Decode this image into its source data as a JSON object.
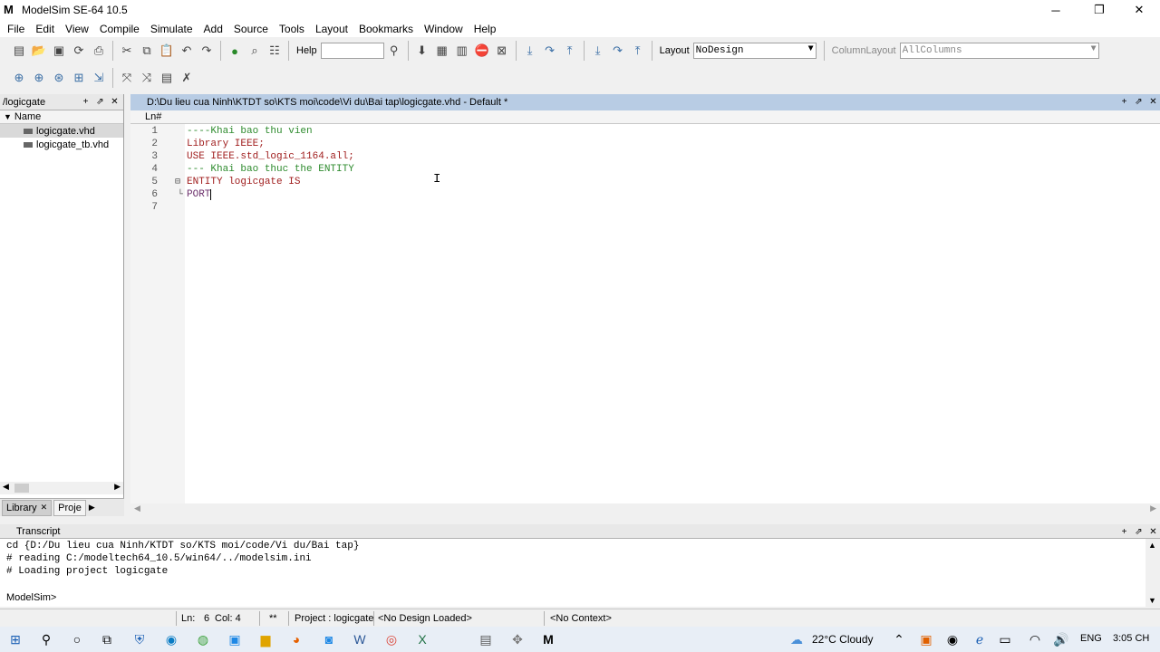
{
  "window": {
    "title": "ModelSim SE-64 10.5",
    "app_icon": "M",
    "minimize": "─",
    "restore": "❐",
    "close": "✕"
  },
  "menu": [
    "File",
    "Edit",
    "View",
    "Compile",
    "Simulate",
    "Add",
    "Source",
    "Tools",
    "Layout",
    "Bookmarks",
    "Window",
    "Help"
  ],
  "toolbar": {
    "help_label": "Help",
    "layout_label": "Layout",
    "layout_value": "NoDesign",
    "column_layout_label": "ColumnLayout",
    "column_layout_value": "AllColumns"
  },
  "left_panel": {
    "title": "/logicgate",
    "column_header": "Name",
    "files": [
      {
        "name": "logicgate.vhd",
        "selected": true
      },
      {
        "name": "logicgate_tb.vhd",
        "selected": false
      }
    ],
    "tabs": [
      "Library",
      "Proje"
    ]
  },
  "editor": {
    "path": "D:\\Du lieu cua Ninh\\KTDT so\\KTS moi\\code\\Vi du\\Bai tap\\logicgate.vhd - Default *",
    "ln_header": "Ln#",
    "lines": [
      {
        "num": "1",
        "text": "----Khai bao thu vien",
        "kind": "comment"
      },
      {
        "num": "2",
        "text": "Library IEEE;",
        "kind": "keyword"
      },
      {
        "num": "3",
        "text": "USE IEEE.std_logic_1164.all;",
        "kind": "keyword"
      },
      {
        "num": "4",
        "text": "--- Khai bao thuc the ENTITY",
        "kind": "comment"
      },
      {
        "num": "5",
        "text": "ENTITY logicgate IS",
        "kind": "keyword"
      },
      {
        "num": "6",
        "text": "PORT",
        "kind": "plain"
      },
      {
        "num": "7",
        "text": "",
        "kind": "plain"
      }
    ]
  },
  "transcript": {
    "title": "Transcript",
    "lines": [
      "cd {D:/Du lieu cua Ninh/KTDT so/KTS moi/code/Vi du/Bai tap}",
      "# reading C:/modeltech64_10.5/win64/../modelsim.ini",
      "# Loading project logicgate"
    ],
    "prompt": "ModelSim>"
  },
  "status": {
    "ln": "Ln:",
    "ln_val": "6",
    "col": "Col: 4",
    "stars": "**",
    "project": "Project : logicgate",
    "design": "<No Design Loaded>",
    "context": "<No Context>"
  },
  "taskbar": {
    "weather": "22°C  Cloudy",
    "lang": "ENG",
    "time": "3:05 CH"
  }
}
